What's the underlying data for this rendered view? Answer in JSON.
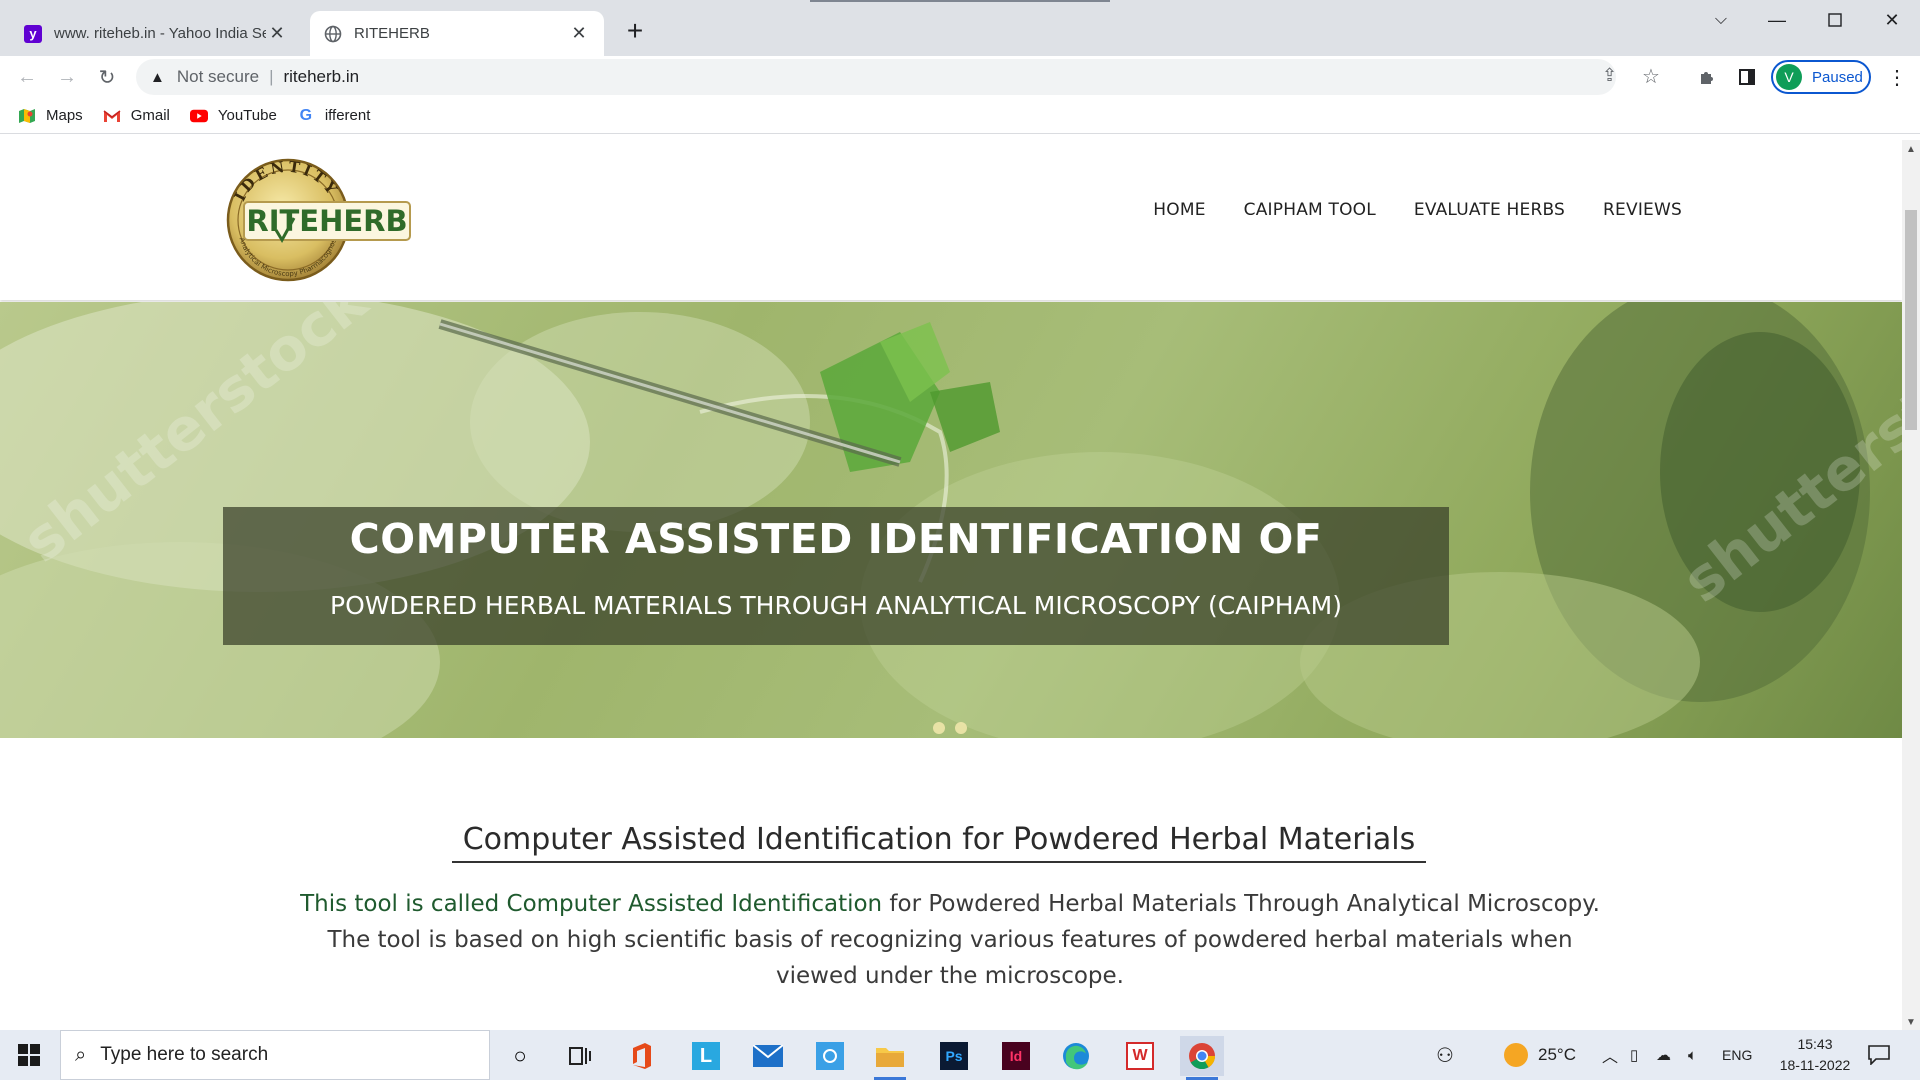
{
  "browser": {
    "tabs": [
      {
        "title": "www. riteheb.in - Yahoo India Se",
        "favicon": "yahoo-icon",
        "active": false
      },
      {
        "title": "RITEHERB",
        "favicon": "globe-icon",
        "active": true
      }
    ],
    "new_tab_label": "+",
    "address": {
      "security_label": "Not secure",
      "url": "riteherb.in"
    },
    "profile": {
      "initial": "V",
      "status": "Paused"
    },
    "bookmarks": [
      {
        "label": "Maps",
        "icon": "maps-icon"
      },
      {
        "label": "Gmail",
        "icon": "gmail-icon"
      },
      {
        "label": "YouTube",
        "icon": "youtube-icon"
      },
      {
        "label": "ifferent",
        "icon": "google-icon"
      }
    ]
  },
  "site": {
    "logo": {
      "arc_text": "IDENTITY",
      "brand": "RITEHERB",
      "ring_text": "Analytical Microscopy Pharmacognosy"
    },
    "nav": [
      "HOME",
      "CAIPHAM TOOL",
      "EVALUATE HERBS",
      "REVIEWS"
    ],
    "hero": {
      "title": "COMPUTER ASSISTED IDENTIFICATION OF",
      "subtitle": "POWDERED HERBAL MATERIALS THROUGH ANALYTICAL MICROSCOPY (CAIPHAM)",
      "watermark": "shutterstock",
      "slides": 2
    },
    "section_heading": "Computer Assisted Identification for Powdered Herbal Materials",
    "intro": {
      "highlight": "This tool is called Computer Assisted Identification",
      "rest_line1": " for Powdered Herbal Materials Through Analytical Microscopy.",
      "line2": "The tool is based on high scientific basis of recognizing various features of powdered herbal materials when",
      "line3": "viewed under the microscope."
    }
  },
  "taskbar": {
    "search_placeholder": "Type here to search",
    "apps": [
      "cortana-icon",
      "task-view-icon",
      "office-icon",
      "l-app-icon",
      "mail-icon",
      "store-icon",
      "file-explorer-icon",
      "photoshop-icon",
      "indesign-icon",
      "edge-icon",
      "wps-icon",
      "chrome-icon"
    ],
    "weather": "25°C",
    "language": "ENG",
    "time": "15:43",
    "date": "18-11-2022"
  },
  "colors": {
    "accent_green": "#1f5a2e",
    "chrome_blue": "#0b57d0"
  }
}
